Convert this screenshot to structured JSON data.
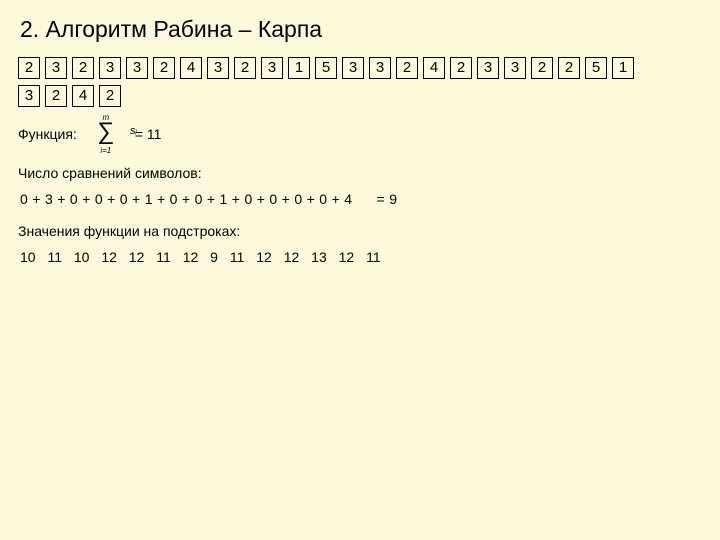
{
  "title": "2. Алгоритм Рабина – Карпа",
  "text_row": [
    "2",
    "3",
    "2",
    "3",
    "3",
    "2",
    "4",
    "3",
    "2",
    "3",
    "1",
    "5",
    "3",
    "3",
    "2",
    "4",
    "2",
    "3",
    "3",
    "2",
    "2",
    "5",
    "1"
  ],
  "pattern_row": [
    "3",
    "2",
    "4",
    "2"
  ],
  "function_label": "Функция:",
  "sigma": {
    "upper": "m",
    "lower": "i=1",
    "term": "sᵢ"
  },
  "function_value": "= 11",
  "comparisons_label": "Число сравнений символов:",
  "comparisons_expr": "0  + 3  + 0  + 0 + 0  + 1 + 0 + 0 + 1  + 0 + 0 + 0 + 0 + 4",
  "comparisons_result": "=  9",
  "substring_values_label": "Значения функции на подстроках:",
  "substring_values": "10  11  10  12 12  11 12   9  11  12 12 13 12 11"
}
